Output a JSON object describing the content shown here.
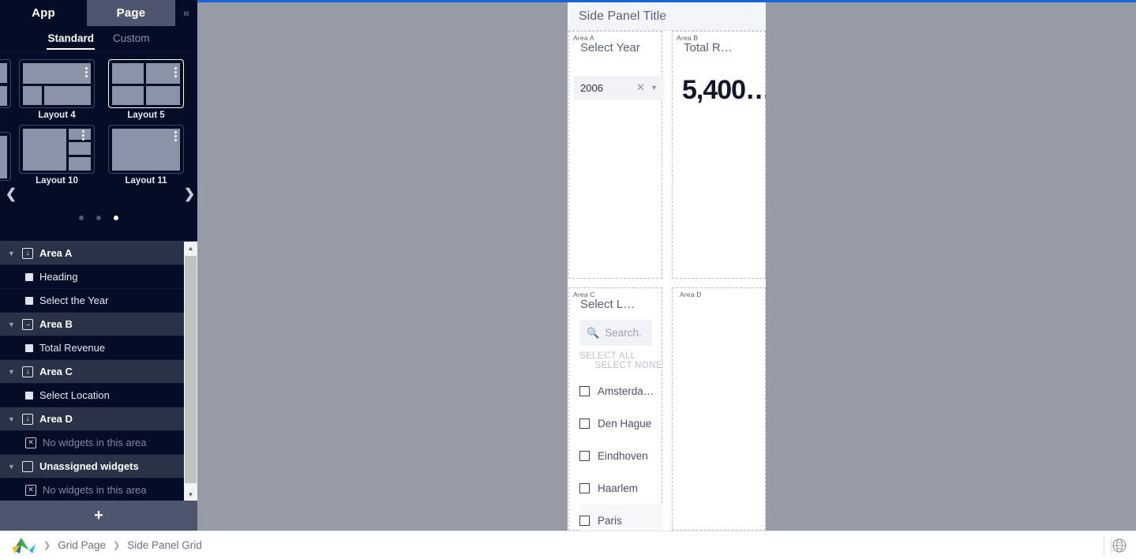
{
  "left_panel": {
    "top_tabs": [
      {
        "label": "App",
        "active": false
      },
      {
        "label": "Page",
        "active": true
      }
    ],
    "collapse_icon": "chevron-double-left-icon",
    "sub_tabs": [
      {
        "label": "Standard",
        "active": true
      },
      {
        "label": "Custom",
        "active": false
      }
    ],
    "gallery": {
      "prev_icon": "chevron-left-icon",
      "next_icon": "chevron-right-icon",
      "layouts": [
        {
          "name": "Layout 4",
          "selected": false
        },
        {
          "name": "Layout 5",
          "selected": true
        },
        {
          "name": "Layout 10",
          "selected": false
        },
        {
          "name": "Layout 11",
          "selected": false
        }
      ],
      "pager": {
        "total": 3,
        "current": 3
      }
    },
    "tree": [
      {
        "label": "Area A",
        "type": "area",
        "icon": "area-down-icon",
        "caret": "caret-down-icon"
      },
      {
        "label": "Heading",
        "type": "widget",
        "icon": "widget-square-icon"
      },
      {
        "label": "Select the Year",
        "type": "widget",
        "icon": "widget-square-icon"
      },
      {
        "label": "Area B",
        "type": "area",
        "icon": "area-right-icon",
        "caret": "caret-down-icon"
      },
      {
        "label": "Total Revenue",
        "type": "widget",
        "icon": "widget-square-icon"
      },
      {
        "label": "Area C",
        "type": "area",
        "icon": "area-down-icon",
        "caret": "caret-down-icon"
      },
      {
        "label": "Select Location",
        "type": "widget",
        "icon": "widget-square-icon"
      },
      {
        "label": "Area D",
        "type": "area",
        "icon": "area-down-icon",
        "caret": "caret-down-icon"
      },
      {
        "label": "No widgets in this area",
        "type": "empty",
        "icon": "empty-x-icon"
      },
      {
        "label": "Unassigned widgets",
        "type": "area",
        "icon": "unassigned-box-icon",
        "caret": "caret-down-icon"
      },
      {
        "label": "No widgets in this area",
        "type": "empty",
        "icon": "empty-x-icon"
      }
    ],
    "scrollbar": {
      "up_icon": "scroll-up-icon",
      "down_icon": "scroll-down-icon"
    },
    "add_button": {
      "label": "+",
      "icon": "plus-icon"
    }
  },
  "side_panel": {
    "title": "Side Panel Title",
    "areas": {
      "a": {
        "tag": "Area A",
        "widget_title": "Select Year",
        "select": {
          "value": "2006",
          "clear_icon": "clear-x-icon",
          "caret_icon": "caret-down-icon"
        }
      },
      "b": {
        "tag": "Area B",
        "widget_title": "Total R…",
        "value": "5,400…"
      },
      "c": {
        "tag": "Area C",
        "widget_title": "Select L…",
        "search": {
          "placeholder": "Search.",
          "value": "",
          "icon": "search-icon"
        },
        "select_all_label": "SELECT ALL",
        "select_none_label": "SELECT NONE",
        "options": [
          {
            "label": "Amsterda…",
            "checked": false,
            "highlighted": false
          },
          {
            "label": "Den Hague",
            "checked": false,
            "highlighted": false
          },
          {
            "label": "Eindhoven",
            "checked": false,
            "highlighted": false
          },
          {
            "label": "Haarlem",
            "checked": false,
            "highlighted": false
          },
          {
            "label": "Paris",
            "checked": false,
            "highlighted": true
          }
        ]
      },
      "d": {
        "tag": "Area D",
        "widget_title": ""
      }
    }
  },
  "bottom_bar": {
    "logo_icon": "app-logo-icon",
    "breadcrumbs": [
      {
        "label": "Grid Page"
      },
      {
        "label": "Side Panel Grid"
      }
    ],
    "separator": "›",
    "globe_icon": "globe-icon"
  },
  "colors": {
    "panel_bg": "#050d26",
    "panel_row_area": "#2a3248",
    "canvas": "#969ba6",
    "accent_blue": "#1862dc",
    "addbar": "#4d566d"
  }
}
